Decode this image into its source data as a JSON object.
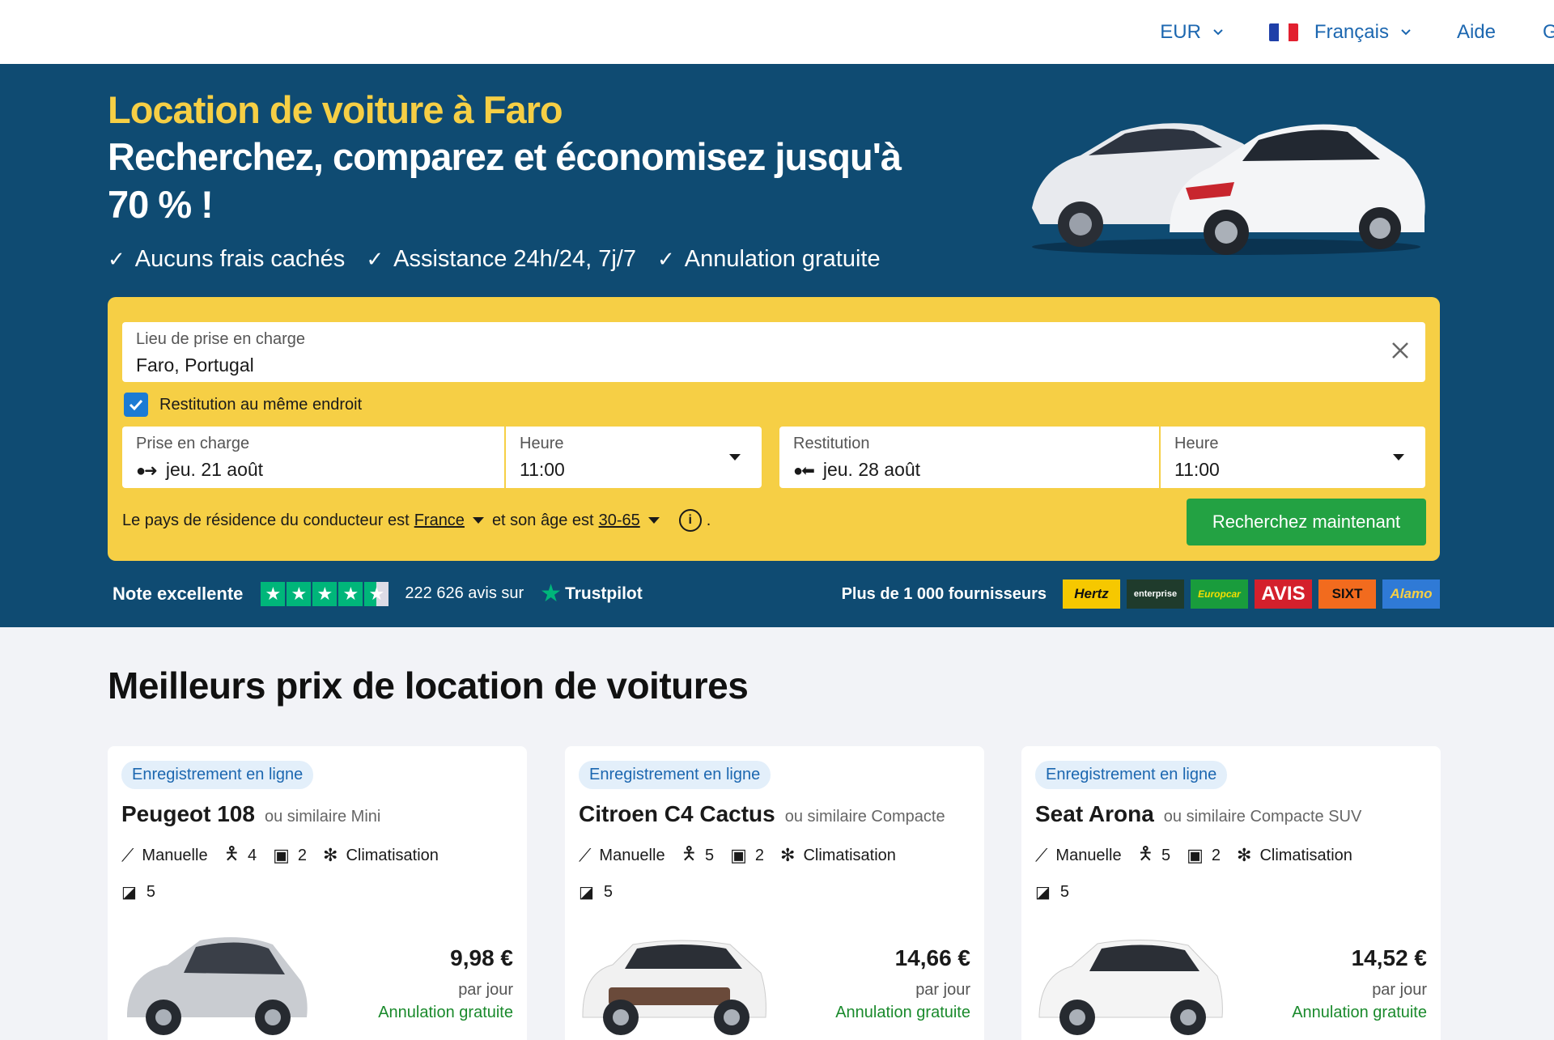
{
  "nav": {
    "currency": "EUR",
    "language": "Français",
    "help": "Aide",
    "more": "G"
  },
  "hero": {
    "title": "Location de voiture à Faro",
    "subtitle": "Recherchez, comparez et économisez jusqu'à 70 % !",
    "perks": [
      "Aucuns frais cachés",
      "Assistance 24h/24, 7j/7",
      "Annulation gratuite"
    ]
  },
  "search": {
    "pickup_location_label": "Lieu de prise en charge",
    "pickup_location_value": "Faro, Portugal",
    "same_return_label": "Restitution au même endroit",
    "same_return_checked": true,
    "pickup_date_label": "Prise en charge",
    "pickup_date_value": "jeu. 21 août",
    "pickup_time_label": "Heure",
    "pickup_time_value": "11:00",
    "return_date_label": "Restitution",
    "return_date_value": "jeu. 28 août",
    "return_time_label": "Heure",
    "return_time_value": "11:00",
    "residence_prefix": "Le pays de résidence du conducteur est",
    "residence_country": "France",
    "age_prefix": "et son âge est",
    "age_value": "30-65",
    "age_suffix": ".",
    "search_button": "Recherchez maintenant"
  },
  "rating": {
    "label": "Note excellente",
    "stars": 4.5,
    "reviews": "222 626 avis sur",
    "brand": "Trustpilot"
  },
  "providers": {
    "label": "Plus de 1 000 fournisseurs",
    "logos": [
      "Hertz",
      "enterprise",
      "Europcar",
      "AVIS",
      "SIXT",
      "Alamo"
    ]
  },
  "offers": {
    "title": "Meilleurs prix de location de voitures",
    "cards": [
      {
        "badge": "Enregistrement en ligne",
        "name": "Peugeot 108",
        "similar": "ou similaire Mini",
        "transmission": "Manuelle",
        "seats": "4",
        "bags": "2",
        "ac": "Climatisation",
        "doors": "5",
        "price": "9,98 €",
        "per": "par jour",
        "cancel": "Annulation gratuite",
        "color": "#c9ccd1"
      },
      {
        "badge": "Enregistrement en ligne",
        "name": "Citroen C4 Cactus",
        "similar": "ou similaire Compacte",
        "transmission": "Manuelle",
        "seats": "5",
        "bags": "2",
        "ac": "Climatisation",
        "doors": "5",
        "price": "14,66 €",
        "per": "par jour",
        "cancel": "Annulation gratuite",
        "color": "#f1f1f1"
      },
      {
        "badge": "Enregistrement en ligne",
        "name": "Seat Arona",
        "similar": "ou similaire Compacte SUV",
        "transmission": "Manuelle",
        "seats": "5",
        "bags": "2",
        "ac": "Climatisation",
        "doors": "5",
        "price": "14,52 €",
        "per": "par jour",
        "cancel": "Annulation gratuite",
        "color": "#f4f4f4"
      }
    ]
  },
  "colors": {
    "hero_bg": "#0f4b72",
    "accent_yellow": "#f6cf45",
    "search_green": "#23a243",
    "link_blue": "#1c67b0"
  }
}
